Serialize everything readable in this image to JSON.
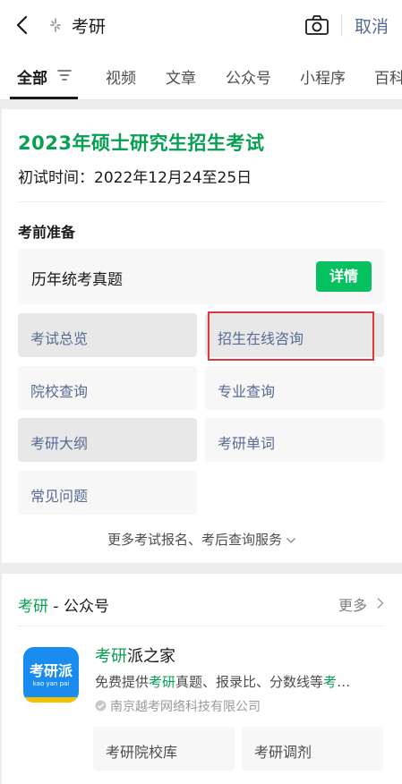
{
  "search": {
    "query": "考研",
    "cancel_label": "取消"
  },
  "tabs": [
    {
      "label": "全部",
      "active": true
    },
    {
      "label": "视频"
    },
    {
      "label": "文章"
    },
    {
      "label": "公众号"
    },
    {
      "label": "小程序"
    },
    {
      "label": "百科"
    }
  ],
  "exam_card": {
    "title": "2023年硕士研究生招生考试",
    "date": "初试时间：2022年12月24至25日",
    "section_label": "考前准备",
    "past_papers": {
      "label": "历年统考真题",
      "button": "详情"
    },
    "grid": [
      {
        "label": "考试总览"
      },
      {
        "label": "招生在线咨询",
        "highlighted": true
      },
      {
        "label": "院校查询"
      },
      {
        "label": "专业查询"
      },
      {
        "label": "考研大纲"
      },
      {
        "label": "考研单词"
      },
      {
        "label": "常见问题"
      }
    ],
    "more_services": "更多考试报名、考后查询服务"
  },
  "official_accounts": {
    "header_keyword": "考研",
    "header_rest": " - 公众号",
    "more": "更多",
    "account": {
      "name_keyword": "考研",
      "name_rest": "派之家",
      "desc_pre": "免费提供",
      "desc_kw1": "考研",
      "desc_mid": "真题、报录比、分数线等",
      "desc_kw2": "考",
      "desc_ellipsis": "…",
      "verified": "南京越考网络科技有限公司",
      "avatar_text": "考研派",
      "avatar_sub": "kao yan pai"
    },
    "buttons": [
      {
        "label": "考研院校库"
      },
      {
        "label": "考研调剂"
      }
    ]
  },
  "colors": {
    "green": "#07a052",
    "button_green": "#07c160",
    "link_blue": "#576b95",
    "highlight_red": "#e0363a"
  }
}
